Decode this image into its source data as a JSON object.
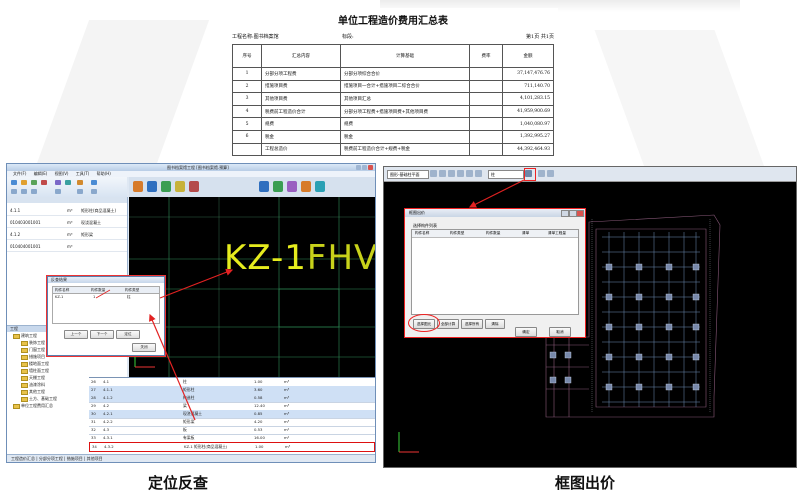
{
  "summary": {
    "title": "单位工程造价费用汇总表",
    "project_label": "工程名称:图书档案馆",
    "section_label": "标段:",
    "page_label": "第1页  共1页",
    "headers": [
      "序号",
      "汇总内容",
      "计算基础",
      "费率",
      "金额"
    ],
    "rows": [
      {
        "no": "1",
        "name": "分部分项工程费",
        "basis": "分部分项综合合价",
        "rate": "",
        "amount": "37,147,476.76"
      },
      {
        "no": "2",
        "name": "措施项目费",
        "basis": "措施项目一合计+措施项目二综合合价",
        "rate": "",
        "amount": "711,140.70"
      },
      {
        "no": "3",
        "name": "其他项目费",
        "basis": "其他项目汇总",
        "rate": "",
        "amount": "4,101,283.15"
      },
      {
        "no": "4",
        "name": "税费前工程造价合计",
        "basis": "分部分项工程费+措施项目费+其他项目费",
        "rate": "",
        "amount": "41,959,900.69"
      },
      {
        "no": "5",
        "name": "规费",
        "basis": "规费",
        "rate": "",
        "amount": "1,040,080.97"
      },
      {
        "no": "6",
        "name": "税金",
        "basis": "税金",
        "rate": "",
        "amount": "1,392,995.27"
      },
      {
        "no": "",
        "name": "工程总造价",
        "basis": "税费前工程造价合计+规费+税金",
        "rate": "",
        "amount": "44,392,464.93"
      }
    ]
  },
  "left_app": {
    "title": "图书档案馆工程  [图书档案馆.预算]",
    "menu": [
      "文件(F)",
      "编辑(E)",
      "视图(V)",
      "工具(T)",
      "帮助(H)"
    ],
    "cad_text": "KZ-1",
    "cad_text_overlap": "FHVQ",
    "left_rows": [
      {
        "code": "4.1.1",
        "a": "m³"
      },
      {
        "code": "010403001001",
        "a": "m³"
      },
      {
        "code": "4.1.2",
        "a": "m³"
      },
      {
        "code": "010404001001",
        "a": "m³"
      }
    ],
    "left_row_text": [
      "矩形柱(商品混凝土)",
      "现浇混凝土",
      "矩形梁"
    ],
    "tree_header": "工程",
    "tree_items": [
      "建筑工程",
      "装饰工程",
      "门窗工程",
      "措施项目",
      "楼地面工程",
      "墙柱面工程",
      "天棚工程",
      "油漆涂料",
      "其他工程",
      "土方、基础工程",
      "单位工程费用汇总"
    ],
    "dialog": {
      "title": "反查结果",
      "headers": [
        "构件名称",
        "构件数量",
        "构件类型"
      ],
      "row": [
        "KZ-1",
        "1",
        "柱"
      ],
      "buttons": [
        "上一个",
        "下一个",
        "定位",
        "关闭"
      ]
    },
    "grid_rows": [
      {
        "no": "26",
        "code": "4.1",
        "name": "柱",
        "qty": "1.00",
        "unit": "m³"
      },
      {
        "no": "27",
        "code": "4.1.1",
        "name": "矩形柱",
        "qty": "3.60",
        "unit": "m³"
      },
      {
        "no": "28",
        "code": "4.1.2",
        "name": "构造柱",
        "qty": "0.58",
        "unit": "m³"
      },
      {
        "no": "29",
        "code": "4.2",
        "name": "梁",
        "qty": "12.40",
        "unit": "m³"
      },
      {
        "no": "30",
        "code": "4.2.1",
        "name": "现浇混凝土",
        "qty": "0.85",
        "unit": "m³"
      },
      {
        "no": "31",
        "code": "4.2.2",
        "name": "矩形梁",
        "qty": "4.20",
        "unit": "m³"
      },
      {
        "no": "32",
        "code": "4.3",
        "name": "板",
        "qty": "0.53",
        "unit": "m²"
      },
      {
        "no": "33",
        "code": "4.3.1",
        "name": "有梁板",
        "qty": "16.00",
        "unit": "m²"
      },
      {
        "no": "34",
        "code": "4.3.2",
        "name": "KZ-1 矩形柱(商品混凝土)",
        "qty": "1.00",
        "unit": "m³"
      }
    ],
    "status": "工程造价汇总  |  分部分项工程  |  措施项目  |  其他项目"
  },
  "right_app": {
    "layer_combo": "图形-基础柱平面",
    "sub_combo": "柱",
    "dialog": {
      "title": "框图出价",
      "list_label": "选择构件列表",
      "headers": [
        "构件名称",
        "构件类型",
        "构件数量",
        "清单",
        "清单工程量"
      ],
      "buttons": [
        "选择图元",
        "全部计算",
        "选择所有",
        "清除",
        "确定",
        "取消"
      ]
    }
  },
  "captions": {
    "left": "定位反查",
    "right": "框图出价"
  },
  "colors": {
    "highlight": "#e22222",
    "cad_text": "#e6ec1e",
    "cad_bg": "#000000",
    "cad_lines": "#2e8b57"
  }
}
